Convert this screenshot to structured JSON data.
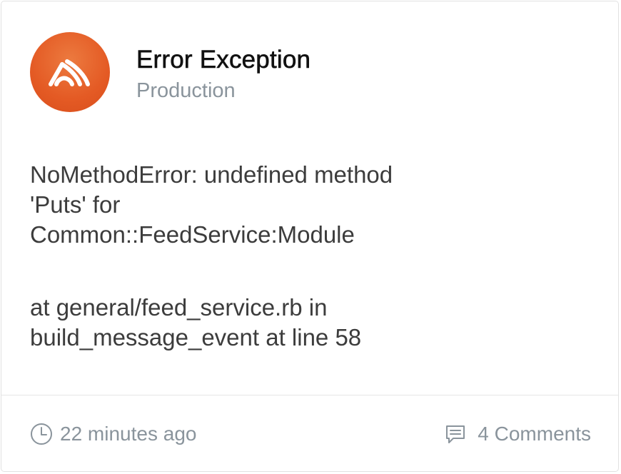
{
  "notification": {
    "title": "Error Exception",
    "environment": "Production",
    "message_lines": [
      "NoMethodError: undefined method",
      "'Puts' for",
      "Common::FeedService:Module"
    ],
    "location_lines": [
      "at general/feed_service.rb in",
      "build_message_event at line 58"
    ],
    "timestamp": "22 minutes ago",
    "comments": "4 Comments"
  },
  "icons": {
    "avatar": "sentry-logo-icon",
    "timestamp": "clock-icon",
    "comments": "comment-icon"
  },
  "colors": {
    "brand": "#e45a24",
    "title": "#111111",
    "body_text": "#3c3c3c",
    "muted_text": "#8a949c",
    "divider": "#e6e6e6"
  }
}
